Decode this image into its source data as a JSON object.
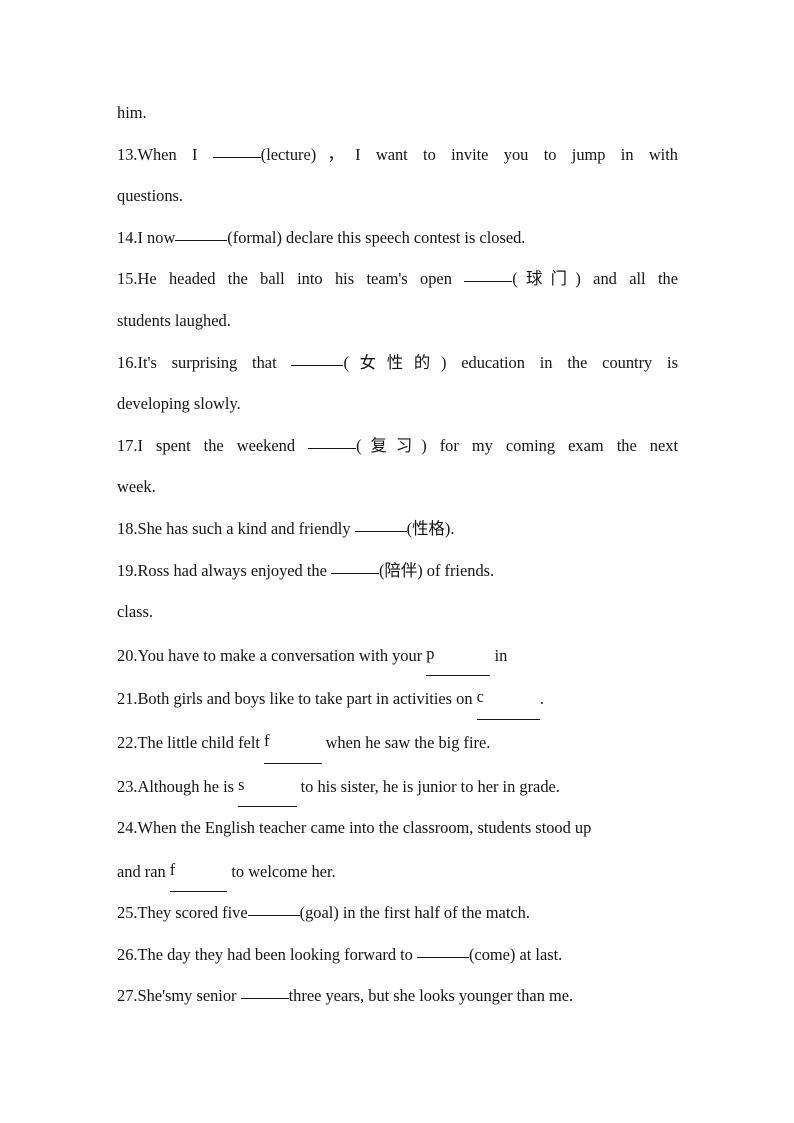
{
  "document": {
    "type": "worksheet",
    "subject": "English fill-in-the-blank exercise",
    "page_background": "#ffffff",
    "text_color": "#141414"
  },
  "lines": [
    {
      "id": "carryover-him",
      "kind": "continuation",
      "text": "him."
    },
    {
      "id": "q13",
      "kind": "question",
      "number": "13.",
      "before": "When I ",
      "blank": true,
      "after": "(lecture)，I want to invite you to jump in with",
      "justified": true,
      "wrap_text": "questions."
    },
    {
      "id": "q14",
      "kind": "question",
      "number": "14.",
      "before": "I now",
      "blank": true,
      "after": "(formal) declare this speech contest is closed."
    },
    {
      "id": "q15",
      "kind": "question",
      "number": "15.",
      "before": "He headed the ball into his team's open ",
      "blank": true,
      "after": "(球门) and all the",
      "justified": true,
      "wrap_text": "students laughed."
    },
    {
      "id": "q16",
      "kind": "question",
      "number": "16.",
      "before": "It's surprising that ",
      "blank": true,
      "after": "(女性的) education in the country is",
      "justified": true,
      "wrap_text": "developing slowly."
    },
    {
      "id": "q17",
      "kind": "question",
      "number": "17.",
      "before": "I spent the weekend ",
      "blank": true,
      "after": "(复习) for my coming exam the next",
      "justified": true,
      "wrap_text": "week."
    },
    {
      "id": "q18",
      "kind": "question",
      "number": "18.",
      "before": "She has such a kind and friendly ",
      "blank": true,
      "after": "(性格)."
    },
    {
      "id": "q19",
      "kind": "question",
      "number": "19.",
      "before": "Ross had always enjoyed the ",
      "blank": true,
      "after": "(陪伴) of friends."
    },
    {
      "id": "carryover-class",
      "kind": "continuation",
      "text": "class."
    },
    {
      "id": "q20",
      "kind": "question",
      "number": "20.",
      "before": "You have to make a conversation with your ",
      "hint_letter": "p",
      "after": " in"
    },
    {
      "id": "q21",
      "kind": "question",
      "number": "21.",
      "before": "Both girls and boys like to take part in activities on ",
      "hint_letter": "c",
      "after": "."
    },
    {
      "id": "q22",
      "kind": "question",
      "number": "22.",
      "before": "The little child felt ",
      "hint_letter": "f",
      "after": " when he saw the big fire."
    },
    {
      "id": "q23",
      "kind": "question",
      "number": "23.",
      "before": "Although he is ",
      "hint_letter": "s",
      "after": " to his sister, he is junior to her in grade."
    },
    {
      "id": "q24",
      "kind": "question",
      "number": "24.",
      "text_line1": "When the English teacher came into the classroom, students stood up",
      "wrap_before": "and ran ",
      "hint_letter": "f",
      "wrap_after": " to welcome her."
    },
    {
      "id": "q25",
      "kind": "question",
      "number": "25.",
      "before": "They scored five",
      "blank": true,
      "after": "(goal) in the first half of the match."
    },
    {
      "id": "q26",
      "kind": "question",
      "number": "26.",
      "before": "The day they had been looking forward to ",
      "blank": true,
      "after": "(come) at last."
    },
    {
      "id": "q27",
      "kind": "question",
      "number": "27.",
      "before": "She'smy senior ",
      "blank": true,
      "after": "three years, but she looks younger than me."
    }
  ]
}
